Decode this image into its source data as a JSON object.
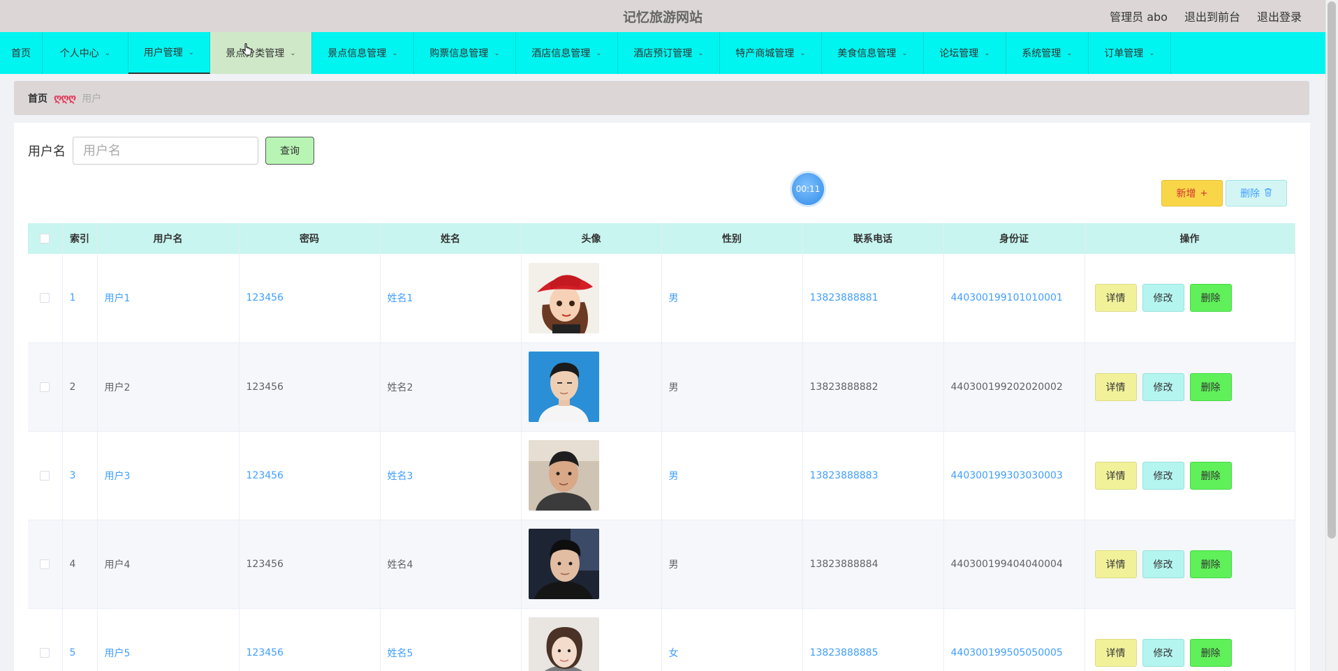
{
  "header": {
    "site_title": "记忆旅游网站",
    "admin_label": "管理员 abo",
    "front_link": "退出到前台",
    "logout_link": "退出登录"
  },
  "nav": {
    "items": [
      {
        "label": "首页",
        "has_chevron": false
      },
      {
        "label": "个人中心",
        "has_chevron": true
      },
      {
        "label": "用户管理",
        "has_chevron": true,
        "active": true
      },
      {
        "label": "景点分类管理",
        "has_chevron": true,
        "hover": true
      },
      {
        "label": "景点信息管理",
        "has_chevron": true
      },
      {
        "label": "购票信息管理",
        "has_chevron": true
      },
      {
        "label": "酒店信息管理",
        "has_chevron": true
      },
      {
        "label": "酒店预订管理",
        "has_chevron": true
      },
      {
        "label": "特产商城管理",
        "has_chevron": true
      },
      {
        "label": "美食信息管理",
        "has_chevron": true
      },
      {
        "label": "论坛管理",
        "has_chevron": true
      },
      {
        "label": "系统管理",
        "has_chevron": true
      },
      {
        "label": "订单管理",
        "has_chevron": true
      }
    ]
  },
  "breadcrumb": {
    "home": "首页",
    "separator": "ღღღ",
    "current": "用户"
  },
  "search": {
    "label": "用户名",
    "placeholder": "用户名",
    "value": "",
    "query_button": "查询"
  },
  "timer": "00:11",
  "actions": {
    "add_label": "新增",
    "add_icon": "+",
    "delete_label": "删除",
    "delete_icon": "🗑"
  },
  "table": {
    "columns": [
      "索引",
      "用户名",
      "密码",
      "姓名",
      "头像",
      "性别",
      "联系电话",
      "身份证",
      "操作"
    ],
    "rows": [
      {
        "index": "1",
        "username": "用户1",
        "password": "123456",
        "name": "姓名1",
        "avatar": "avatar-cartoon-girl-red-hat",
        "gender": "男",
        "phone": "13823888881",
        "id_card": "440300199101010001"
      },
      {
        "index": "2",
        "username": "用户2",
        "password": "123456",
        "name": "姓名2",
        "avatar": "avatar-man-blue-background",
        "gender": "男",
        "phone": "13823888882",
        "id_card": "440300199202020002"
      },
      {
        "index": "3",
        "username": "用户3",
        "password": "123456",
        "name": "姓名3",
        "avatar": "avatar-man-selfie",
        "gender": "男",
        "phone": "13823888883",
        "id_card": "440300199303030003"
      },
      {
        "index": "4",
        "username": "用户4",
        "password": "123456",
        "name": "姓名4",
        "avatar": "avatar-man-dark",
        "gender": "男",
        "phone": "13823888884",
        "id_card": "440300199404040004"
      },
      {
        "index": "5",
        "username": "用户5",
        "password": "123456",
        "name": "姓名5",
        "avatar": "avatar-woman-sweater",
        "gender": "女",
        "phone": "13823888885",
        "id_card": "440300199505050005"
      }
    ],
    "row_actions": {
      "detail": "详情",
      "edit": "修改",
      "delete": "删除"
    }
  },
  "colors": {
    "nav_bg": "#00f5f0",
    "header_bg": "#dcd6d6",
    "link_blue": "#409eff",
    "table_header_bg": "#c8f5f0"
  }
}
